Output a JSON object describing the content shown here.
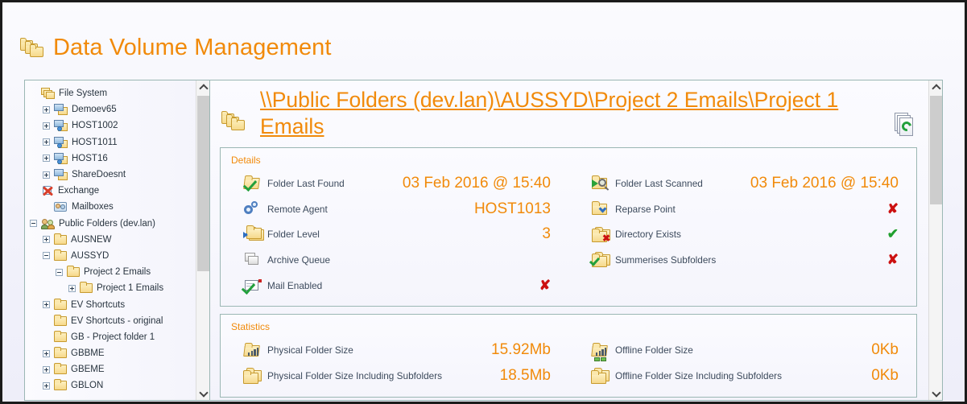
{
  "app": {
    "title": "Data Volume Management",
    "accent": "#f18a0a",
    "label_color": "#3c4a5c",
    "border_color": "#9bb7b4"
  },
  "tree": {
    "items": [
      {
        "label": "File System",
        "indent": 0,
        "expander": "none",
        "icon": "folders-stack-icon"
      },
      {
        "label": "Demoev65",
        "indent": 1,
        "expander": "plus",
        "icon": "server-drive-icon"
      },
      {
        "label": "HOST1002",
        "indent": 1,
        "expander": "plus",
        "icon": "server-drive-agent-icon"
      },
      {
        "label": "HOST1011",
        "indent": 1,
        "expander": "plus",
        "icon": "server-drive-agent-icon"
      },
      {
        "label": "HOST16",
        "indent": 1,
        "expander": "plus",
        "icon": "server-drive-agent-icon"
      },
      {
        "label": "ShareDoesnt",
        "indent": 1,
        "expander": "plus",
        "icon": "server-drive-icon"
      },
      {
        "label": "Exchange",
        "indent": 0,
        "expander": "none",
        "icon": "exchange-icon"
      },
      {
        "label": "Mailboxes",
        "indent": 1,
        "expander": "none",
        "icon": "mailboxes-icon"
      },
      {
        "label": "Public Folders (dev.lan)",
        "indent": 0,
        "expander": "minus",
        "icon": "public-folders-icon"
      },
      {
        "label": "AUSNEW",
        "indent": 1,
        "expander": "plus",
        "icon": "folder-icon"
      },
      {
        "label": "AUSSYD",
        "indent": 1,
        "expander": "minus",
        "icon": "folder-icon"
      },
      {
        "label": "Project 2 Emails",
        "indent": 2,
        "expander": "minus",
        "icon": "folder-icon"
      },
      {
        "label": "Project 1 Emails",
        "indent": 3,
        "expander": "plus",
        "icon": "folder-icon"
      },
      {
        "label": "EV Shortcuts",
        "indent": 1,
        "expander": "plus",
        "icon": "folder-icon"
      },
      {
        "label": "EV Shortcuts - original",
        "indent": 1,
        "expander": "none",
        "icon": "folder-icon"
      },
      {
        "label": "GB - Project folder 1",
        "indent": 1,
        "expander": "none",
        "icon": "folder-icon"
      },
      {
        "label": "GBBME",
        "indent": 1,
        "expander": "plus",
        "icon": "folder-icon"
      },
      {
        "label": "GBEME",
        "indent": 1,
        "expander": "plus",
        "icon": "folder-icon"
      },
      {
        "label": "GBLON",
        "indent": 1,
        "expander": "plus",
        "icon": "folder-icon"
      }
    ]
  },
  "content": {
    "path_title": "\\\\Public Folders (dev.lan)\\AUSSYD\\Project 2 Emails\\Project 1 Emails",
    "refresh_icon": "refresh-pages-icon"
  },
  "details": {
    "title": "Details",
    "left": [
      {
        "label": "Folder Last Found",
        "value": "03 Feb 2016 @ 15:40",
        "type": "text",
        "icon": "folder-check-icon"
      },
      {
        "label": "Remote Agent",
        "value": "HOST1013",
        "type": "text",
        "icon": "gears-icon"
      },
      {
        "label": "Folder Level",
        "value": "3",
        "type": "text",
        "icon": "folder-stack-arrow-icon"
      },
      {
        "label": "Archive Queue",
        "value": "",
        "type": "text",
        "icon": "gray-stack-icon"
      },
      {
        "label": "Mail Enabled",
        "value": "✘",
        "type": "no",
        "icon": "mail-check-icon"
      }
    ],
    "right": [
      {
        "label": "Folder Last Scanned",
        "value": "03 Feb 2016 @ 15:40",
        "type": "text",
        "icon": "folder-scan-icon"
      },
      {
        "label": "Reparse Point",
        "value": "✘",
        "type": "no",
        "icon": "folder-reparse-icon"
      },
      {
        "label": "Directory Exists",
        "value": "✔",
        "type": "yes",
        "icon": "folder-stack-cross-icon"
      },
      {
        "label": "Summerises Subfolders",
        "value": "✘",
        "type": "no",
        "icon": "folder-stack-check-icon"
      }
    ]
  },
  "statistics": {
    "title": "Statistics",
    "left": [
      {
        "label": "Physical Folder Size",
        "value": "15.92Mb",
        "icon": "folder-chart-icon"
      },
      {
        "label": "Physical Folder Size Including Subfolders",
        "value": "18.5Mb",
        "icon": "folder-chart-stack-icon"
      }
    ],
    "right": [
      {
        "label": "Offline Folder Size",
        "value": "0Kb",
        "icon": "folder-chart-network-icon"
      },
      {
        "label": "Offline Folder Size Including Subfolders",
        "value": "0Kb",
        "icon": "folder-chart-network-stack-icon"
      }
    ]
  },
  "scrollbars": {
    "up_arrow": "chevron-up-icon",
    "down_arrow": "chevron-down-icon"
  }
}
